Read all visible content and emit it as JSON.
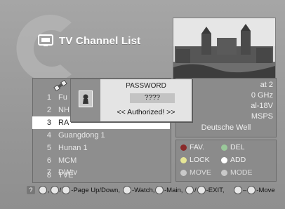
{
  "header": {
    "title": "TV Channel List"
  },
  "dialog": {
    "title": "PASSWORD",
    "value": "????",
    "status": "<< Authorized! >>"
  },
  "channels": [
    {
      "num": "1",
      "name": "Fu"
    },
    {
      "num": "2",
      "name": "NH"
    },
    {
      "num": "3",
      "name": "RA"
    },
    {
      "num": "4",
      "name": "Guangdong 1"
    },
    {
      "num": "5",
      "name": "Hunan 1"
    },
    {
      "num": "6",
      "name": "MCM"
    },
    {
      "num": "7",
      "name": "DWtv"
    },
    {
      "num": "8",
      "name": "TVE"
    }
  ],
  "selected_channel_index": 2,
  "info": {
    "satellite": "at 2",
    "frequency": "0 GHz",
    "polarity": "al-18V",
    "symbol_rate": "MSPS",
    "channel_name": "Deutsche Well"
  },
  "legend": {
    "fav": "FAV.",
    "del": "DEL",
    "lock": "LOCK",
    "add": "ADD",
    "move": "MOVE",
    "mode": "MODE",
    "colors": {
      "fav": "#8a2a2a",
      "del": "#9ac89a",
      "lock": "#e6e696",
      "add": "#ffffff",
      "move": "#c9c9c9",
      "mode": "#c9c9c9"
    }
  },
  "help": {
    "page": "-Page Up/Down,",
    "watch": "-Watch,",
    "main": "-Main,",
    "exit": "-EXIT,",
    "move": "-Move",
    "separator": ",",
    "slash": "/",
    "dash": "–"
  }
}
